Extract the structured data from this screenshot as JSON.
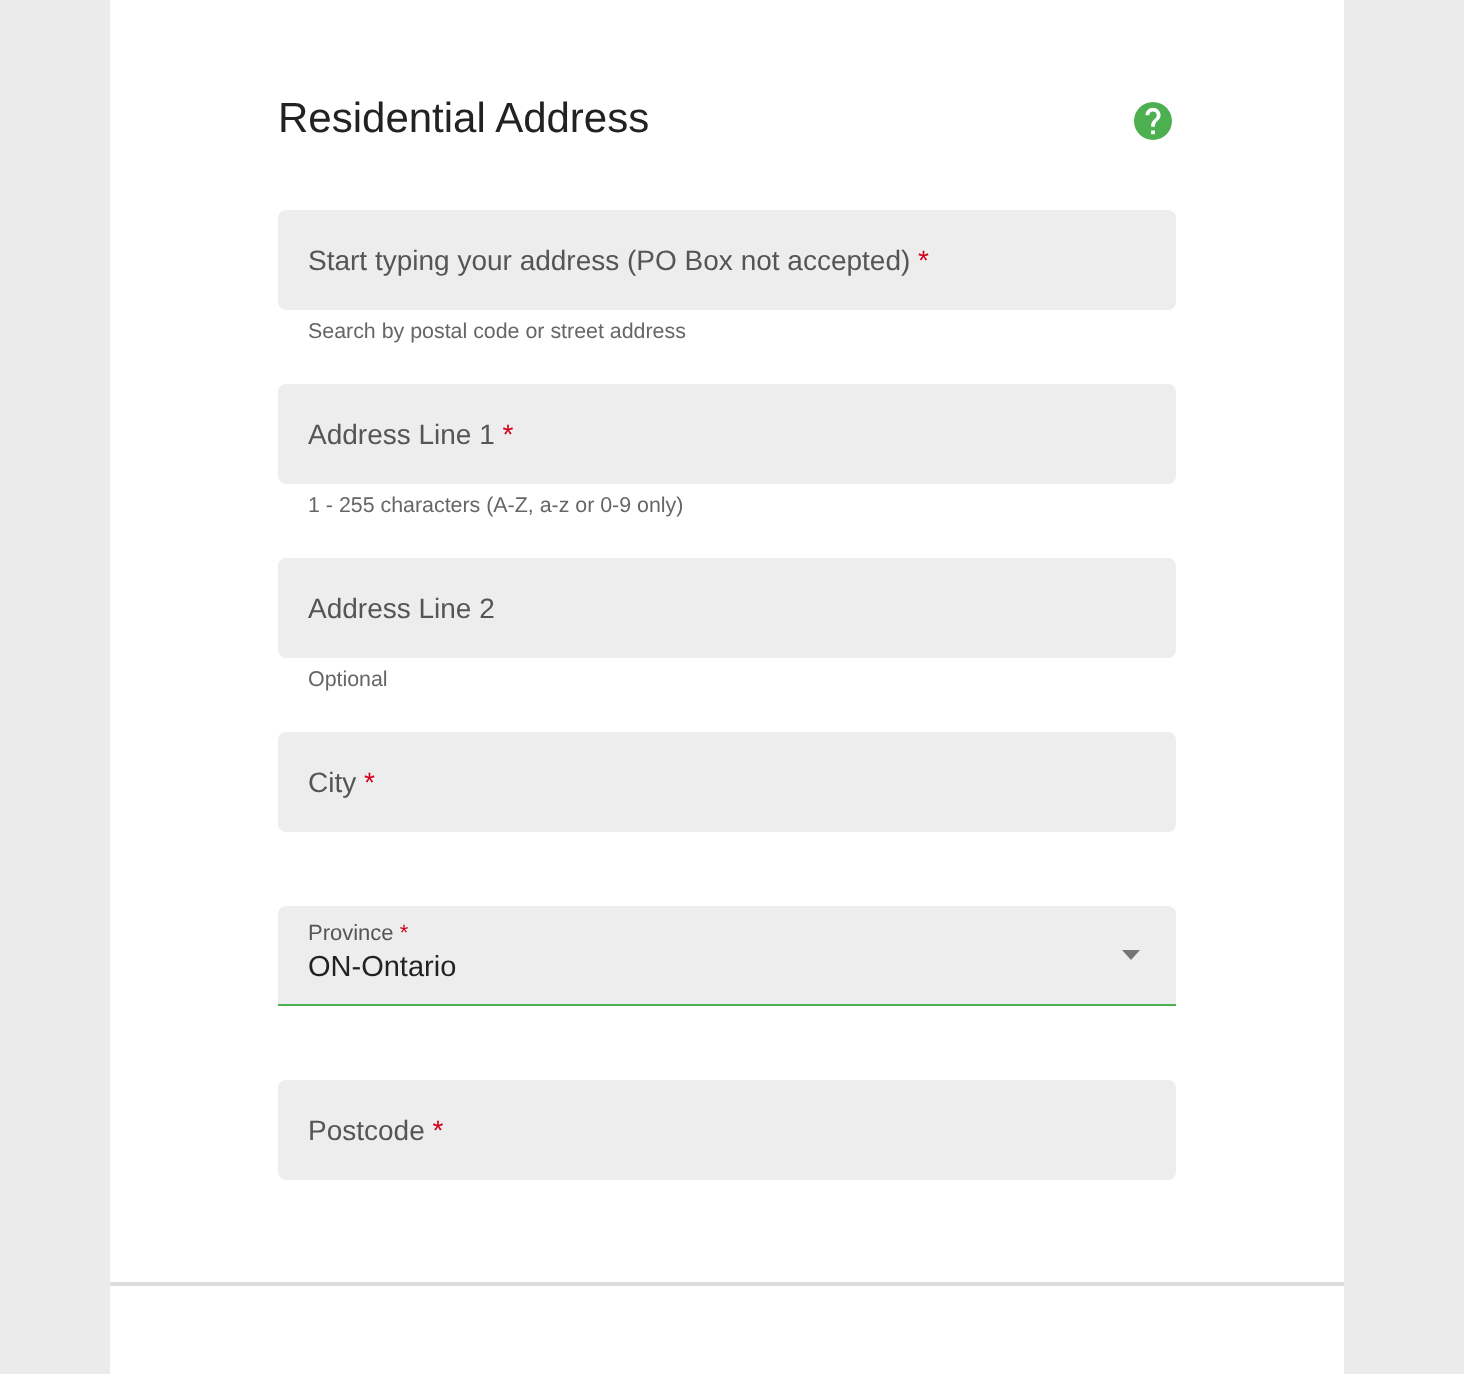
{
  "section": {
    "title": "Residential Address"
  },
  "fields": [
    {
      "kind": "text",
      "label": "Start typing your address (PO Box not accepted)",
      "required_mark": "*",
      "hint": "Search by postal code or street address",
      "focused": false
    },
    {
      "kind": "text",
      "label": "Address Line 1",
      "required_mark": "*",
      "hint": "1 - 255 characters (A-Z, a-z or 0-9 only)",
      "focused": false
    },
    {
      "kind": "text",
      "label": "Address Line 2",
      "hint": "Optional",
      "focused": false
    },
    {
      "kind": "text",
      "label": "City",
      "required_mark": "*",
      "focused": false
    },
    {
      "kind": "select",
      "label": "Province",
      "required_mark": "*",
      "value": "ON-Ontario",
      "focused": true
    },
    {
      "kind": "text",
      "label": "Postcode",
      "required_mark": "*",
      "focused": false
    }
  ]
}
